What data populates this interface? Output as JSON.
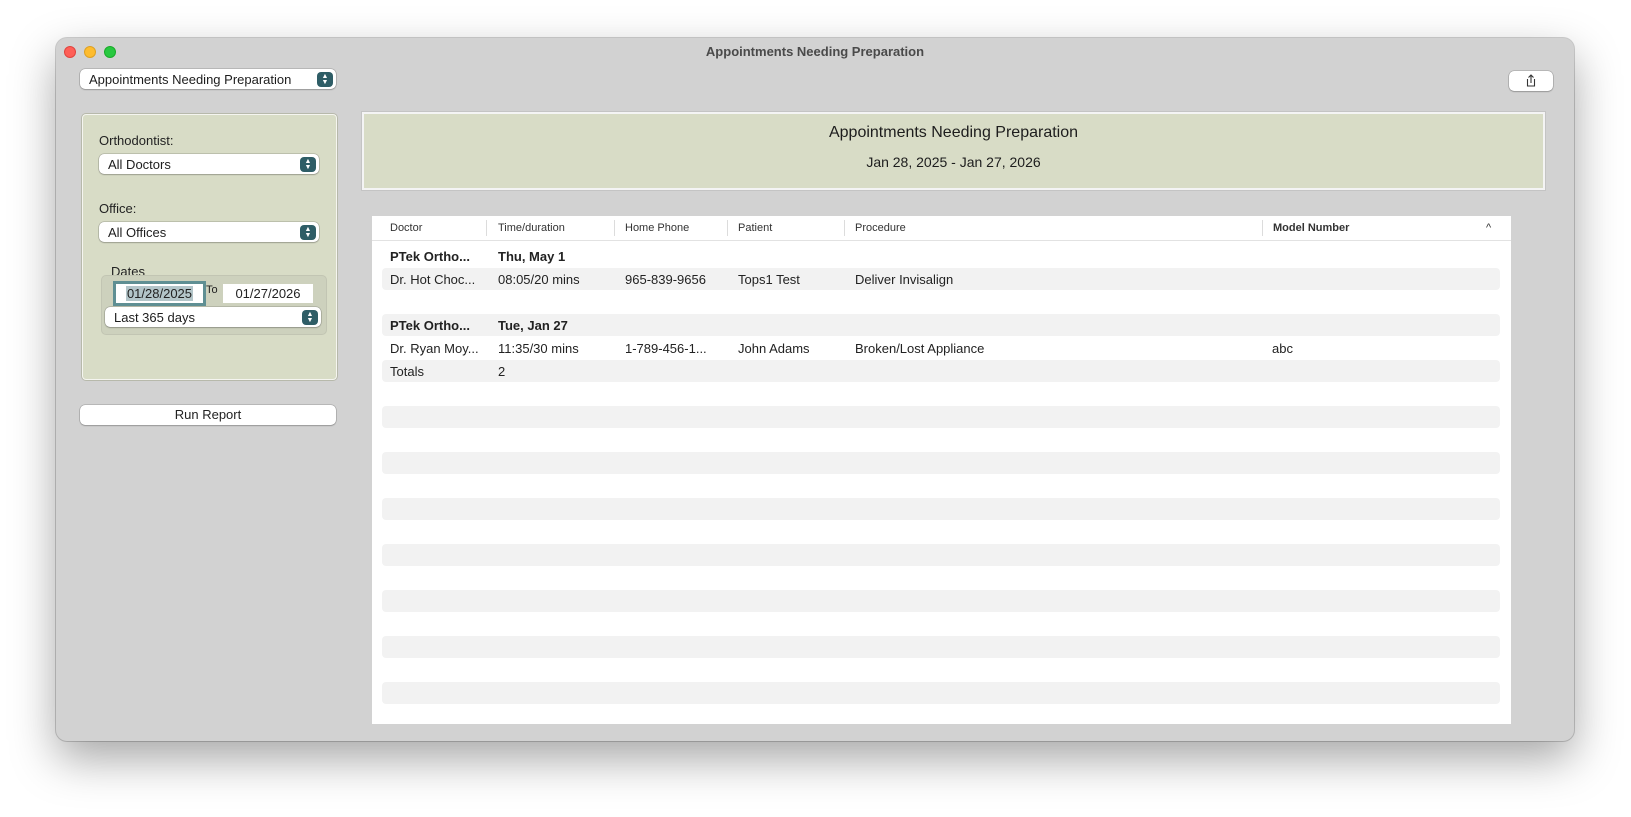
{
  "window": {
    "title": "Appointments Needing Preparation"
  },
  "report_selector": {
    "value": "Appointments Needing Preparation"
  },
  "filters": {
    "orthodontist_label": "Orthodontist:",
    "orthodontist_value": "All Doctors",
    "office_label": "Office:",
    "office_value": "All Offices",
    "dates_label": "Dates",
    "date_from": "01/28/2025",
    "date_to_label": "To",
    "date_to": "01/27/2026",
    "range_value": "Last 365 days"
  },
  "run_button": "Run Report",
  "report": {
    "title": "Appointments Needing Preparation",
    "subtitle": "Jan 28, 2025 - Jan 27, 2026"
  },
  "table": {
    "columns": [
      "Doctor",
      "Time/duration",
      "Home Phone",
      "Patient",
      "Procedure",
      "Model Number"
    ],
    "sort_indicator": "^",
    "rows": [
      {
        "doctor": "PTek Ortho...",
        "time": "Thu, May 1"
      },
      {
        "doctor": "Dr. Hot Choc...",
        "time": "08:05/20 mins",
        "phone": "965-839-9656",
        "patient": "Tops1 Test",
        "procedure": "Deliver Invisalign",
        "model": ""
      },
      {
        "doctor": "PTek Ortho...",
        "time": "Tue, Jan 27"
      },
      {
        "doctor": "Dr. Ryan Moy...",
        "time": "11:35/30 mins",
        "phone": "1-789-456-1...",
        "patient": "John Adams",
        "procedure": "Broken/Lost Appliance",
        "model": "abc"
      },
      {
        "doctor": "Totals",
        "time": "2"
      }
    ]
  },
  "icons": {
    "stepper": "up-down-chevron-icon",
    "share": "share-icon",
    "sort": "chevron-up-icon"
  }
}
